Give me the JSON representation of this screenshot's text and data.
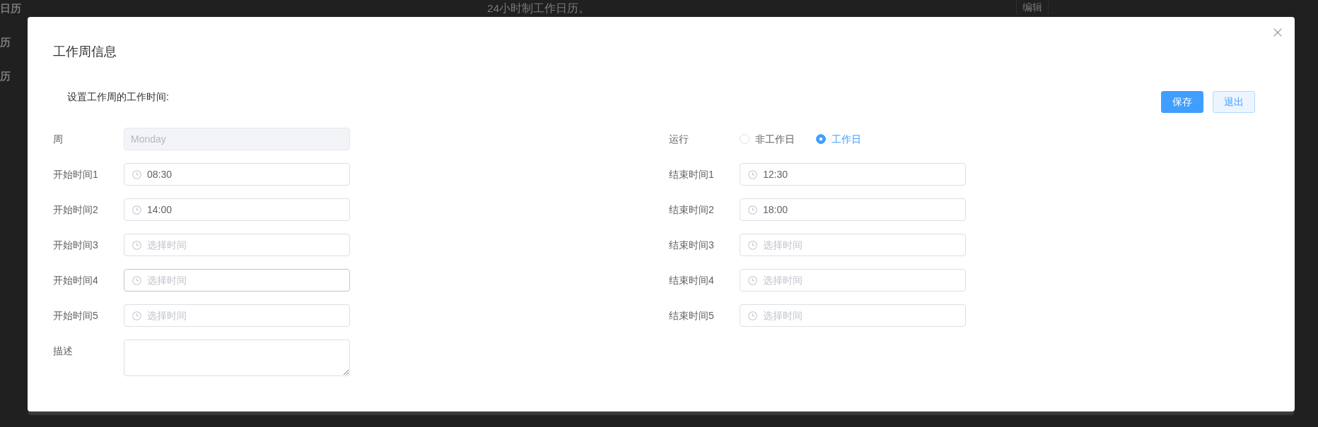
{
  "background_table": {
    "rows": [
      {
        "name": "日历",
        "description": "24小时制工作日历。",
        "action": "编辑"
      },
      {
        "name": "历"
      },
      {
        "name": "历"
      }
    ]
  },
  "dialog": {
    "title": "工作周信息",
    "subtitle": "设置工作周的工作时间:",
    "buttons": [
      {
        "label": "保存",
        "kind": "primary"
      },
      {
        "label": "退出",
        "kind": "plain"
      }
    ],
    "left_fields": [
      {
        "kind": "text",
        "label": "周",
        "value": "Monday",
        "disabled": true,
        "hovered": false
      },
      {
        "kind": "time",
        "label": "开始时间1",
        "value": "08:30",
        "disabled": false,
        "hovered": false
      },
      {
        "kind": "time",
        "label": "开始时间2",
        "value": "14:00",
        "disabled": false,
        "hovered": false
      },
      {
        "kind": "time",
        "label": "开始时间3",
        "placeholder": "选择时间",
        "disabled": false,
        "hovered": false
      },
      {
        "kind": "time",
        "label": "开始时间4",
        "placeholder": "选择时间",
        "disabled": false,
        "hovered": true
      },
      {
        "kind": "time",
        "label": "开始时间5",
        "placeholder": "选择时间",
        "disabled": false,
        "hovered": false
      },
      {
        "kind": "textarea",
        "label": "描述",
        "disabled": false,
        "hovered": false
      }
    ],
    "right_fields": [
      {
        "kind": "radio",
        "label": "运行",
        "options": [
          {
            "label": "非工作日",
            "selected": false
          },
          {
            "label": "工作日",
            "selected": true
          }
        ],
        "disabled": false,
        "hovered": false
      },
      {
        "kind": "time",
        "label": "结束时间1",
        "value": "12:30",
        "disabled": false,
        "hovered": false
      },
      {
        "kind": "time",
        "label": "结束时间2",
        "value": "18:00",
        "disabled": false,
        "hovered": false
      },
      {
        "kind": "time",
        "label": "结束时间3",
        "placeholder": "选择时间",
        "disabled": false,
        "hovered": false
      },
      {
        "kind": "time",
        "label": "结束时间4",
        "placeholder": "选择时间",
        "disabled": false,
        "hovered": false
      },
      {
        "kind": "time",
        "label": "结束时间5",
        "placeholder": "选择时间",
        "disabled": false,
        "hovered": false
      }
    ]
  }
}
